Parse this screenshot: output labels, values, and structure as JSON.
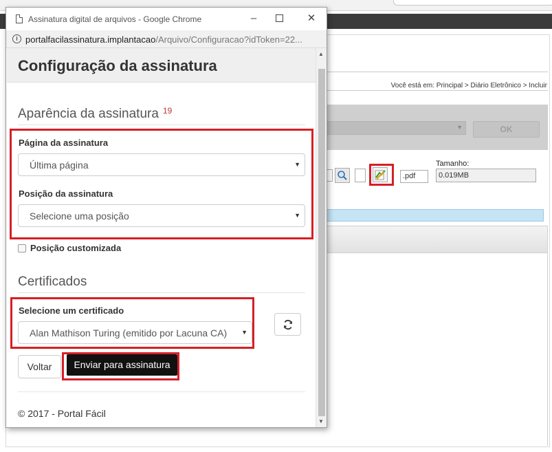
{
  "window": {
    "title": "Assinatura digital de arquivos - Google Chrome",
    "minimize_icon": "minimize-icon",
    "maximize_icon": "maximize-icon",
    "close_icon": "close-icon"
  },
  "address_bar": {
    "url_host": "portalfacilassinatura.implantacao",
    "url_path": "/Arquivo/Configuracao?idToken=22..."
  },
  "dialog": {
    "title": "Configuração da assinatura",
    "appearance_section": {
      "title": "Aparência da assinatura",
      "badge": "19",
      "page_label": "Página da assinatura",
      "page_value": "Última página",
      "position_label": "Posição da assinatura",
      "position_value": "Selecione uma posição",
      "custom_position_label": "Posição customizada"
    },
    "certificates_section": {
      "title": "Certificados",
      "select_label": "Selecione um certificado",
      "select_value": "Alan Mathison Turing (emitido por Lacuna CA)"
    },
    "buttons": {
      "back": "Voltar",
      "submit": "Enviar para assinatura"
    },
    "footer": "© 2017 - Portal Fácil"
  },
  "background_page": {
    "breadcrumb": "Você está em: Principal > Diário Eletrônico > Incluir",
    "ok_button": "OK",
    "size_label": "Tamanho:",
    "size_value": "0.019MB",
    "extension_value": ".pdf"
  },
  "colors": {
    "highlight_red": "#d51f26",
    "submit_button_bg": "#111111",
    "header_bg": "#efefef"
  }
}
